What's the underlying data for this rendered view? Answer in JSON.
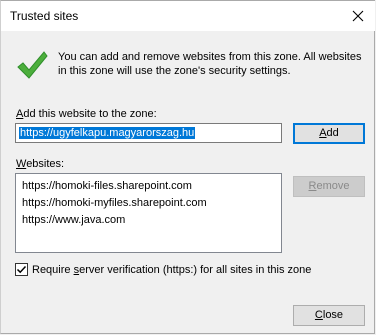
{
  "window": {
    "title": "Trusted sites",
    "close_icon": "close-icon"
  },
  "info": {
    "icon": "checkmark-icon",
    "text": "You can add and remove websites from this zone. All websites in this zone will use the zone's security settings."
  },
  "add_section": {
    "label_mnemonic": "A",
    "label_rest": "dd this website to the zone:",
    "input_value": "https://ugyfelkapu.magyarorszag.hu",
    "add_button_mnemonic": "A",
    "add_button_rest": "dd"
  },
  "websites_section": {
    "label_mnemonic": "W",
    "label_rest": "ebsites:",
    "items": [
      "https://homoki-files.sharepoint.com",
      "https://homoki-myfiles.sharepoint.com",
      "https://www.java.com"
    ],
    "remove_button_mnemonic": "R",
    "remove_button_rest": "emove"
  },
  "require_verification": {
    "checked": true,
    "label_before": "Require ",
    "label_mnemonic": "s",
    "label_after": "erver verification (https:) for all sites in this zone"
  },
  "footer": {
    "close_button_mnemonic": "C",
    "close_button_rest": "lose"
  },
  "colors": {
    "accent": "#0078d7",
    "check_green": "#3aa639"
  }
}
